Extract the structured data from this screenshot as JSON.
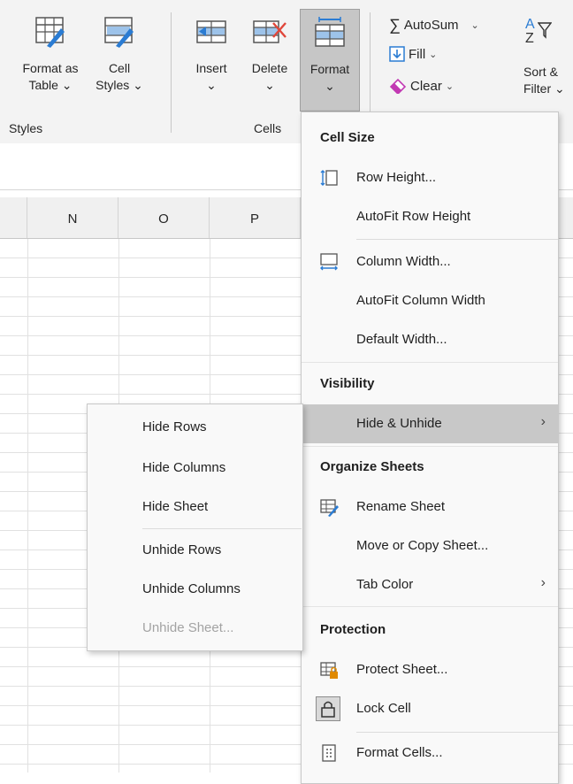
{
  "ribbon": {
    "styles_group": {
      "label": "Styles",
      "format_as_table": {
        "line1": "Format as",
        "line2": "Table ⌄"
      },
      "cell_styles": {
        "line1": "Cell",
        "line2": "Styles ⌄"
      }
    },
    "cells_group": {
      "label": "Cells",
      "insert": {
        "line1": "Insert",
        "line2": "⌄"
      },
      "delete": {
        "line1": "Delete",
        "line2": "⌄"
      },
      "format": {
        "line1": "Format",
        "line2": "⌄"
      }
    },
    "editing_group": {
      "autosum": "AutoSum",
      "fill": "Fill",
      "clear": "Clear",
      "sort_filter": {
        "line1": "Sort &",
        "line2": "Filter ⌄"
      },
      "sort_glyph": "A",
      "sort_glyph2": "Z"
    }
  },
  "columns": [
    "N",
    "O",
    "P"
  ],
  "format_menu": {
    "cell_size_header": "Cell Size",
    "row_height": "Row Height...",
    "autofit_row_height": "AutoFit Row Height",
    "column_width": "Column Width...",
    "autofit_column_width": "AutoFit Column Width",
    "default_width": "Default Width...",
    "visibility_header": "Visibility",
    "hide_unhide": "Hide & Unhide",
    "organize_header": "Organize Sheets",
    "rename_sheet": "Rename Sheet",
    "move_copy_sheet": "Move or Copy Sheet...",
    "tab_color": "Tab Color",
    "protection_header": "Protection",
    "protect_sheet": "Protect Sheet...",
    "lock_cell": "Lock Cell",
    "format_cells": "Format Cells..."
  },
  "hide_unhide_submenu": {
    "hide_rows": "Hide Rows",
    "hide_columns": "Hide Columns",
    "hide_sheet": "Hide Sheet",
    "unhide_rows": "Unhide Rows",
    "unhide_columns": "Unhide Columns",
    "unhide_sheet": "Unhide Sheet..."
  },
  "colors": {
    "ribbon_bg": "#f3f3f3",
    "highlight": "#c8c8c8",
    "accent_blue": "#2b7cd3",
    "lock_orange": "#e08a00",
    "delete_red": "#e0463a",
    "disabled_text": "#a3a3a3"
  }
}
